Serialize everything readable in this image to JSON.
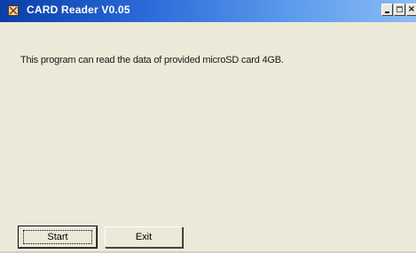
{
  "window": {
    "title": "CARD Reader  V0.05",
    "app_icon": "card-reader-app-icon",
    "controls": {
      "minimize_icon": "minimize-icon",
      "maximize_icon": "maximize-icon",
      "close_glyph": "×"
    }
  },
  "main": {
    "message": "This program can read the data of provided microSD card 4GB."
  },
  "buttons": {
    "start_label": "Start",
    "exit_label": "Exit"
  },
  "colors": {
    "titlebar_start": "#0a3ea8",
    "titlebar_end": "#8cbcf5",
    "window_bg": "#ece9d8"
  }
}
